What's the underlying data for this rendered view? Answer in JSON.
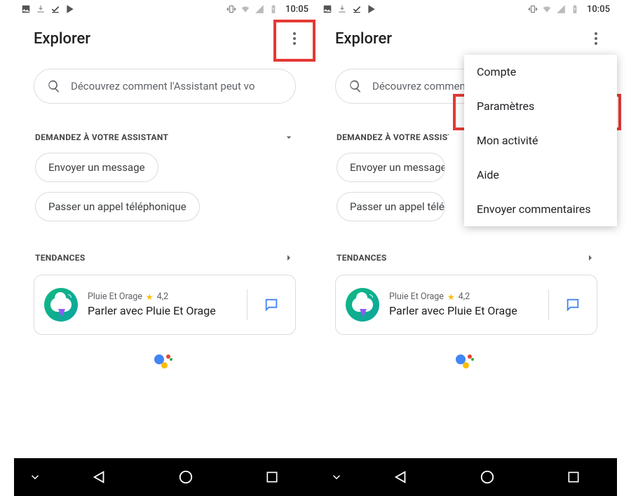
{
  "statusbar": {
    "time": "10:05"
  },
  "topbar": {
    "title": "Explorer"
  },
  "search": {
    "placeholder": "Découvrez comment l'Assistant peut vo"
  },
  "section_assistant": {
    "label": "DEMANDEZ À VOTRE ASSISTANT",
    "chips": [
      "Envoyer un message",
      "Passer un appel téléphonique"
    ]
  },
  "section_trends": {
    "label": "TENDANCES"
  },
  "card": {
    "provider": "Pluie Et Orage",
    "rating": "4,2",
    "title": "Parler avec Pluie Et Orage"
  },
  "menu": {
    "items": [
      "Compte",
      "Paramètres",
      "Mon activité",
      "Aide",
      "Envoyer commentaires"
    ]
  }
}
